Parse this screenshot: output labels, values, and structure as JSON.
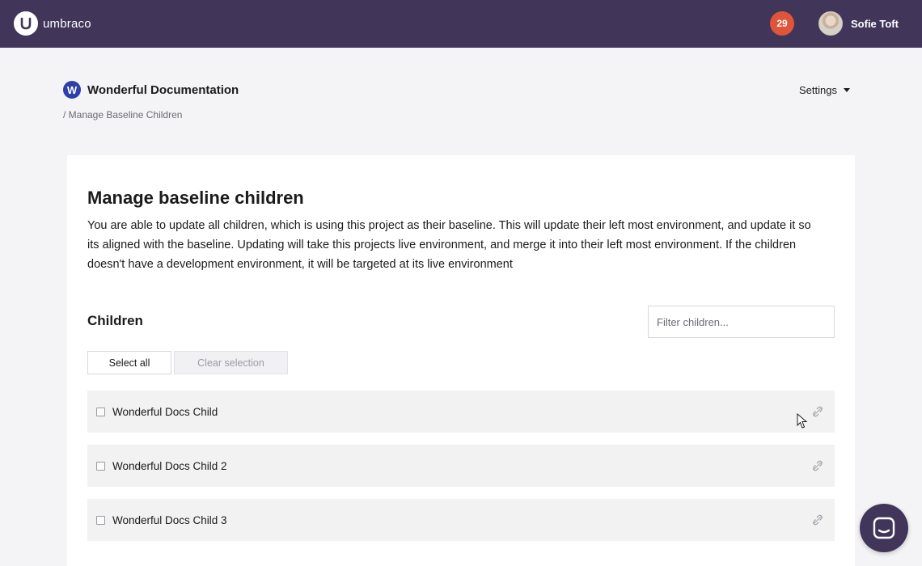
{
  "header": {
    "logo_text": "umbraco",
    "notification_count": "29",
    "user_name": "Sofie Toft"
  },
  "project": {
    "badge_letter": "W",
    "name": "Wonderful Documentation",
    "breadcrumb": "/ Manage Baseline Children",
    "settings_label": "Settings"
  },
  "main": {
    "title": "Manage baseline children",
    "description": "You are able to update all children, which is using this project as their baseline. This will update their left most environment, and update it so its aligned with the baseline. Updating will take this projects live environment, and merge it into their left most environment. If the children doesn't have a development environment, it will be targeted at its live environment",
    "children_title": "Children",
    "filter_placeholder": "Filter children...",
    "select_all_label": "Select all",
    "clear_selection_label": "Clear selection",
    "children": [
      {
        "label": "Wonderful Docs Child",
        "checked": false
      },
      {
        "label": "Wonderful Docs Child 2",
        "checked": false
      },
      {
        "label": "Wonderful Docs Child 3",
        "checked": false
      }
    ]
  },
  "colors": {
    "topbar": "#413659",
    "notification": "#e0543a",
    "project_badge": "#2f3fa8",
    "row_background": "#f2f2f3"
  },
  "icons": {
    "logo": "umbraco-logo-icon",
    "row_action": "unlinked-chain-icon",
    "chat": "chat-icon",
    "settings_caret": "caret-down-icon"
  }
}
